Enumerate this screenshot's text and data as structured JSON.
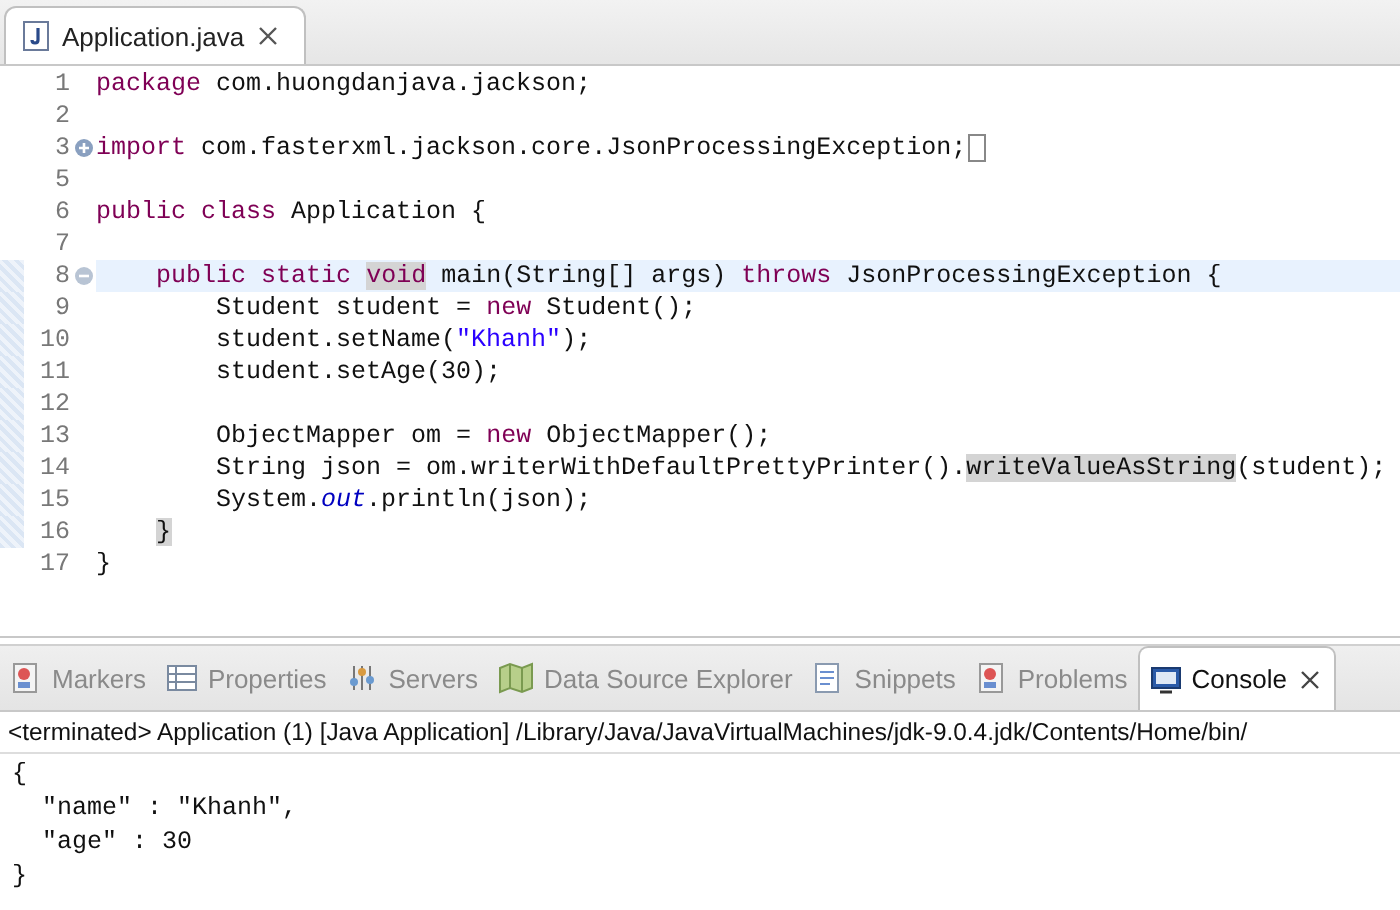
{
  "editor": {
    "tabs": [
      {
        "label": "Application.java",
        "selected": true
      }
    ],
    "lines": [
      {
        "number": "1",
        "current": false,
        "in_range": false,
        "tokens": [
          {
            "text": "package",
            "kind": "keyword"
          },
          {
            "text": " com.huongdanjava.jackson;",
            "kind": "plain"
          }
        ]
      },
      {
        "number": "2",
        "current": false,
        "in_range": false
      },
      {
        "number": "3",
        "fold": {
          "expanded": false
        },
        "current": false,
        "in_range": false,
        "tokens": [
          {
            "text": "import",
            "kind": "keyword"
          },
          {
            "text": " com.fasterxml.jackson.core.JsonProcessingException;",
            "kind": "plain"
          }
        ]
      },
      {
        "number": "5",
        "current": false,
        "in_range": false
      },
      {
        "number": "6",
        "current": false,
        "in_range": false,
        "tokens": [
          {
            "text": "public class",
            "kind": "keyword"
          },
          {
            "text": " Application {",
            "kind": "plain"
          }
        ]
      },
      {
        "number": "7",
        "current": false,
        "in_range": false
      },
      {
        "number": "8",
        "fold": {
          "expanded": true
        },
        "current": true,
        "in_range": true,
        "tokens": [
          {
            "text": "    public static ",
            "kind": "keyword"
          },
          {
            "text": "void",
            "kind": "keyword-marked"
          },
          {
            "text": " main(String[] args) ",
            "kind": "plain"
          },
          {
            "text": "throws",
            "kind": "keyword"
          },
          {
            "text": " JsonProcessingException {",
            "kind": "plain"
          }
        ]
      },
      {
        "number": "9",
        "current": false,
        "in_range": true,
        "tokens": [
          {
            "text": "        Student student = ",
            "kind": "plain"
          },
          {
            "text": "new",
            "kind": "keyword"
          },
          {
            "text": " Student();",
            "kind": "plain"
          }
        ]
      },
      {
        "number": "10",
        "current": false,
        "in_range": true,
        "tokens": [
          {
            "text": "        student.setName(",
            "kind": "plain"
          },
          {
            "text": "\"Khanh\"",
            "kind": "string"
          },
          {
            "text": ");",
            "kind": "plain"
          }
        ]
      },
      {
        "number": "11",
        "current": false,
        "in_range": true,
        "tokens": [
          {
            "text": "        student.setAge(30);",
            "kind": "plain"
          }
        ]
      },
      {
        "number": "12",
        "current": false,
        "in_range": true
      },
      {
        "number": "13",
        "current": false,
        "in_range": true,
        "tokens": [
          {
            "text": "        ObjectMapper om = ",
            "kind": "plain"
          },
          {
            "text": "new",
            "kind": "keyword"
          },
          {
            "text": " ObjectMapper();",
            "kind": "plain"
          }
        ]
      },
      {
        "number": "14",
        "current": false,
        "in_range": true,
        "tokens": [
          {
            "text": "        String json = om.writerWithDefaultPrettyPrinter().",
            "kind": "plain"
          },
          {
            "text": "writeValueAsString",
            "kind": "marked"
          },
          {
            "text": "(student);",
            "kind": "plain"
          }
        ]
      },
      {
        "number": "15",
        "current": false,
        "in_range": true,
        "tokens": [
          {
            "text": "        System.",
            "kind": "plain"
          },
          {
            "text": "out",
            "kind": "static-field"
          },
          {
            "text": ".println(json);",
            "kind": "plain"
          }
        ]
      },
      {
        "number": "16",
        "current": false,
        "in_range": true,
        "tokens": [
          {
            "text": "    }",
            "kind": "marked"
          }
        ]
      },
      {
        "number": "17",
        "current": false,
        "in_range": false,
        "tokens": [
          {
            "text": "}",
            "kind": "plain"
          }
        ]
      }
    ]
  },
  "panel": {
    "tabs": [
      {
        "label": "Markers",
        "kind": "markers",
        "selected": false
      },
      {
        "label": "Properties",
        "kind": "properties",
        "selected": false
      },
      {
        "label": "Servers",
        "kind": "servers",
        "selected": false
      },
      {
        "label": "Data Source Explorer",
        "kind": "datasource",
        "selected": false
      },
      {
        "label": "Snippets",
        "kind": "snippets",
        "selected": false
      },
      {
        "label": "Problems",
        "kind": "problems",
        "selected": false
      },
      {
        "label": "Console",
        "kind": "console",
        "selected": true
      }
    ],
    "console_header": "<terminated> Application (1) [Java Application] /Library/Java/JavaVirtualMachines/jdk-9.0.4.jdk/Contents/Home/bin/",
    "output": [
      "{",
      "  \"name\" : \"Khanh\",",
      "  \"age\" : 30",
      "}"
    ]
  }
}
